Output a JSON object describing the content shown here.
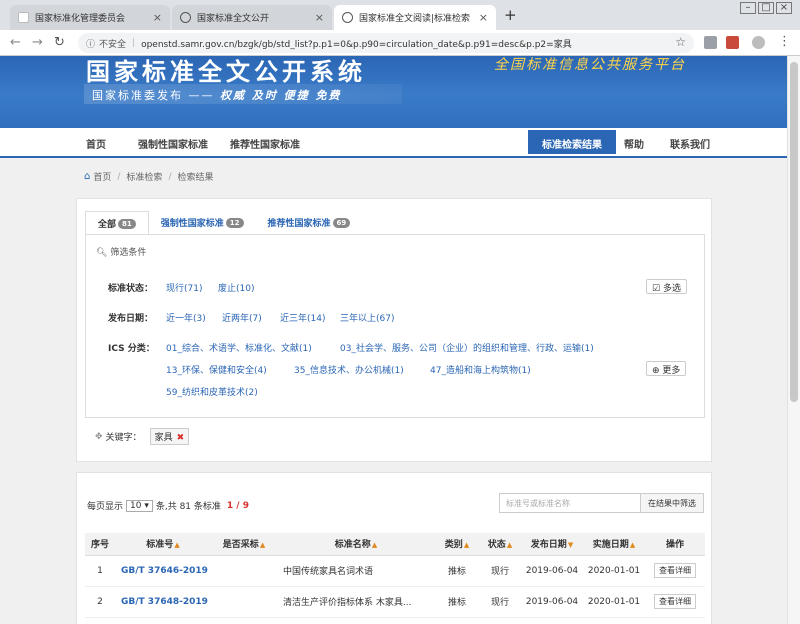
{
  "browser": {
    "tabs": [
      {
        "title": "国家标准化管理委员会"
      },
      {
        "title": "国家标准全文公开"
      },
      {
        "title": "国家标准全文阅读|标准检索"
      }
    ],
    "insecure_label": "不安全",
    "url": "openstd.samr.gov.cn/bzgk/gb/std_list?p.p1=0&p.p90=circulation_date&p.p91=desc&p.p2=家具"
  },
  "banner": {
    "title": "国家标准全文公开系统",
    "slogan_prefix": "国家标准委发布 ——",
    "slogan_emph": "权威 及时 便捷 免费",
    "tagline": "全国标准信息公共服务平台"
  },
  "nav": {
    "home": "首页",
    "mandatory": "强制性国家标准",
    "recommended": "推荐性国家标准",
    "search_results": "标准检索结果",
    "help": "帮助",
    "contact": "联系我们"
  },
  "breadcrumb": {
    "home": "首页",
    "search": "标准检索",
    "results": "检索结果"
  },
  "filters": {
    "tabs": [
      {
        "label": "全部",
        "count": "81"
      },
      {
        "label": "强制性国家标准",
        "count": "12"
      },
      {
        "label": "推荐性国家标准",
        "count": "69"
      }
    ],
    "title": "筛选条件",
    "status_label": "标准状态：",
    "status_options": [
      "现行(71)",
      "废止(10)"
    ],
    "multi_select": "多选",
    "date_label": "发布日期：",
    "date_options": [
      "近一年(3)",
      "近两年(7)",
      "近三年(14)",
      "三年以上(67)"
    ],
    "ics_label": "ICS 分类：",
    "ics_options": [
      "01_综合、术语学、标准化、文献(1)",
      "03_社会学、服务、公司（企业）的组织和管理、行政、运输(1)",
      "13_环保、保健和安全(4)",
      "35_信息技术、办公机械(1)",
      "47_造船和海上构筑物(1)",
      "59_纺织和皮革技术(2)"
    ],
    "more": "更多",
    "keyword_label": "关键字：",
    "keyword": "家具"
  },
  "results": {
    "per_page_label": "每页显示",
    "per_page_value": "10",
    "total_text": "条,共 81 条标准",
    "page_text": "1 / 9",
    "search_placeholder": "标准号或标准名称",
    "search_button": "在结果中筛选",
    "columns": [
      "序号",
      "标准号",
      "是否采标",
      "标准名称",
      "类别",
      "状态",
      "发布日期",
      "实施日期",
      "操作"
    ],
    "rows": [
      {
        "no": "1",
        "code": "GB/T 37646-2019",
        "adopted": "",
        "name": "中国传统家具名词术语",
        "category": "推标",
        "status": "现行",
        "published": "2019-06-04",
        "effective": "2020-01-01",
        "action": "查看详细"
      },
      {
        "no": "2",
        "code": "GB/T 37648-2019",
        "adopted": "",
        "name": "清洁生产评价指标体系 木家具...",
        "category": "推标",
        "status": "现行",
        "published": "2019-06-04",
        "effective": "2020-01-01",
        "action": "查看详细"
      }
    ]
  },
  "colors": {
    "brand": "#2b66b4",
    "accent": "#d9302c"
  }
}
